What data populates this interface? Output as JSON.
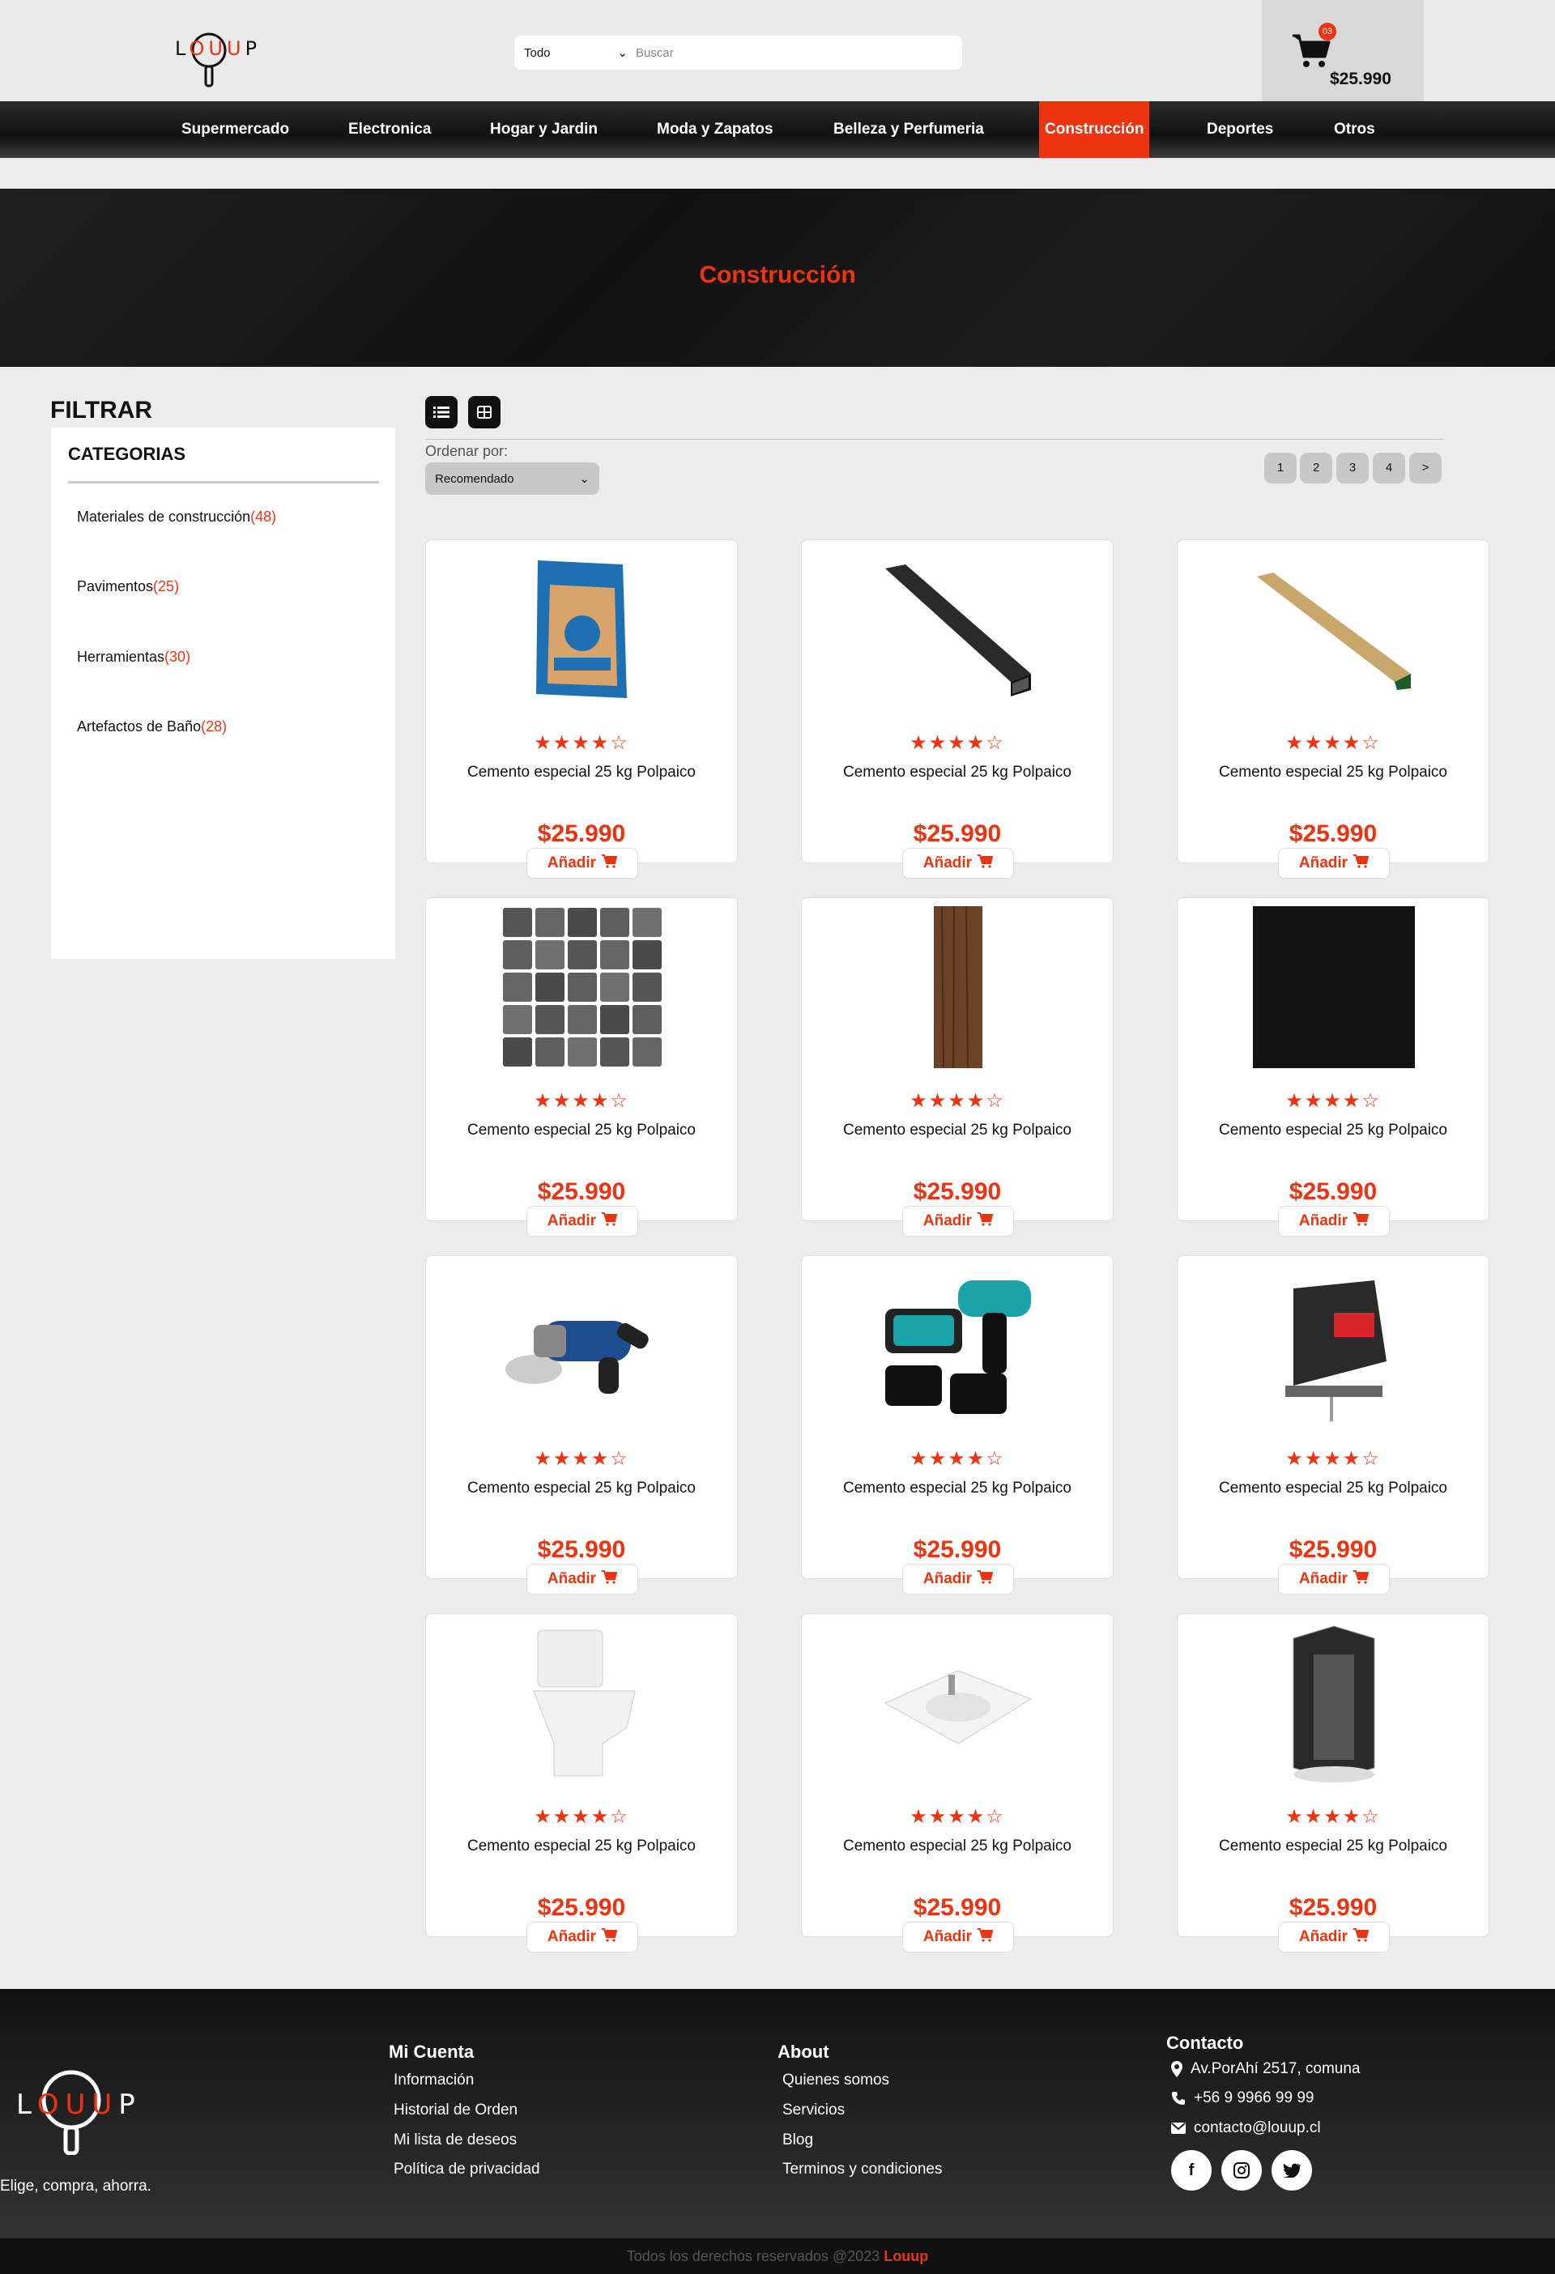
{
  "header": {
    "search_category": "Todo",
    "search_placeholder": "Buscar",
    "cart_count": "03",
    "cart_total": "$25.990"
  },
  "logo": {
    "text_l": "L",
    "text_o1": "O",
    "text_u1": "U",
    "text_u2": "U",
    "text_p": "P"
  },
  "nav": [
    {
      "label": "Supermercado"
    },
    {
      "label": "Electronica"
    },
    {
      "label": "Hogar y Jardin"
    },
    {
      "label": "Moda y Zapatos"
    },
    {
      "label": "Belleza y Perfumeria"
    },
    {
      "label": "Construcción",
      "active": true
    },
    {
      "label": "Deportes"
    },
    {
      "label": "Otros"
    }
  ],
  "hero": {
    "title": "Construcción"
  },
  "sidebar": {
    "filter_title": "FILTRAR",
    "categories_title": "CATEGORIAS",
    "categories": [
      {
        "name": "Materiales de construcción",
        "count": "(48)"
      },
      {
        "name": "Pavimentos",
        "count": "(25)"
      },
      {
        "name": "Herramientas",
        "count": "(30)"
      },
      {
        "name": "Artefactos de Baño",
        "count": "(28)"
      }
    ]
  },
  "toolbar": {
    "order_label": "Ordenar por:",
    "order_value": "Recomendado",
    "pages": [
      "1",
      "2",
      "3",
      "4",
      ">"
    ]
  },
  "accent": "#ee3311",
  "products": [
    {
      "name": "Cemento especial 25 kg Polpaico",
      "price": "$25.990",
      "add": "Añadir",
      "rating": 4,
      "image": "cement-bag-icon"
    },
    {
      "name": "Cemento especial 25 kg Polpaico",
      "price": "$25.990",
      "add": "Añadir",
      "rating": 4,
      "image": "steel-profile-icon"
    },
    {
      "name": "Cemento especial 25 kg Polpaico",
      "price": "$25.990",
      "add": "Añadir",
      "rating": 4,
      "image": "wood-beam-icon"
    },
    {
      "name": "Cemento especial 25 kg Polpaico",
      "price": "$25.990",
      "add": "Añadir",
      "rating": 4,
      "image": "stone-mosaic-icon"
    },
    {
      "name": "Cemento especial 25 kg Polpaico",
      "price": "$25.990",
      "add": "Añadir",
      "rating": 4,
      "image": "wood-plank-icon"
    },
    {
      "name": "Cemento especial 25 kg Polpaico",
      "price": "$25.990",
      "add": "Añadir",
      "rating": 4,
      "image": "black-tile-icon"
    },
    {
      "name": "Cemento especial 25 kg Polpaico",
      "price": "$25.990",
      "add": "Añadir",
      "rating": 4,
      "image": "angle-grinder-icon"
    },
    {
      "name": "Cemento especial 25 kg Polpaico",
      "price": "$25.990",
      "add": "Añadir",
      "rating": 4,
      "image": "cordless-drill-icon"
    },
    {
      "name": "Cemento especial 25 kg Polpaico",
      "price": "$25.990",
      "add": "Añadir",
      "rating": 4,
      "image": "jigsaw-icon"
    },
    {
      "name": "Cemento especial 25 kg Polpaico",
      "price": "$25.990",
      "add": "Añadir",
      "rating": 4,
      "image": "toilet-icon"
    },
    {
      "name": "Cemento especial 25 kg Polpaico",
      "price": "$25.990",
      "add": "Añadir",
      "rating": 4,
      "image": "sink-icon"
    },
    {
      "name": "Cemento especial 25 kg Polpaico",
      "price": "$25.990",
      "add": "Añadir",
      "rating": 4,
      "image": "shower-cabin-icon"
    }
  ],
  "footer": {
    "tagline": "Elige, compra, ahorra.",
    "account_title": "Mi Cuenta",
    "account_links": [
      "Información",
      "Historial de Orden",
      "Mi lista de deseos",
      "Política de privacidad"
    ],
    "about_title": "About",
    "about_links": [
      "Quienes somos",
      "Servicios",
      "Blog",
      "Terminos y condiciones"
    ],
    "contact_title": "Contacto",
    "address": "Av.PorAhí 2517, comuna",
    "phone": "+56 9 9966 99 99",
    "email": "contacto@louup.cl",
    "copyright": "Todos los derechos reservados @2023",
    "brand": "Louup"
  }
}
